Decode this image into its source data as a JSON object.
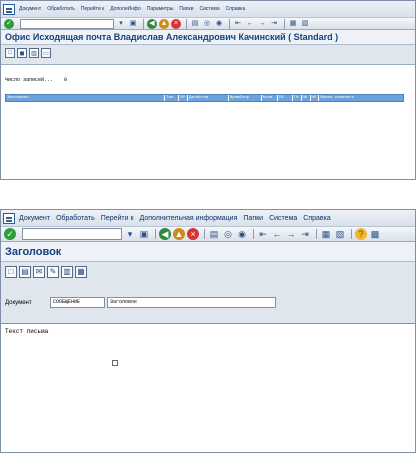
{
  "window1": {
    "menu": [
      "Документ",
      "Обработать",
      "Перейти к",
      "ДополнИнфо",
      "Параметры",
      "Папки",
      "Система",
      "Справка"
    ],
    "command_value": "",
    "title": "Офис  Исходящая почта  Владислав Александрович Качинский  ( Standard )",
    "record_count_label": "Число записей...",
    "record_count": "0",
    "columns": [
      {
        "label": "Заголовок"
      },
      {
        "label": "Тип"
      },
      {
        "label": "ПР"
      },
      {
        "label": "ДатаОтпр"
      },
      {
        "label": "ВремОтпр"
      },
      {
        "label": "Колв"
      },
      {
        "label": "СП"
      },
      {
        "label": "ТФ"
      },
      {
        "label": "ОК"
      },
      {
        "label": "НП"
      },
      {
        "label": "Можно изменить"
      }
    ]
  },
  "window2": {
    "menu": [
      "Документ",
      "Обработать",
      "Перейти к",
      "Дополнительная информация",
      "Папки",
      "Система",
      "Справка"
    ],
    "command_value": "",
    "title": "Заголовок",
    "document_label": "Документ",
    "document_type": "СООБЩЕНИЕ",
    "document_title": "Заголовок",
    "body_text": "Текст письма"
  },
  "icons": {
    "toolbar": [
      "check-icon",
      "save-icon",
      "back-icon",
      "exit-icon",
      "cancel-icon",
      "print-icon",
      "find-icon",
      "find-next-icon",
      "first-page-icon",
      "previous-page-icon",
      "next-page-icon",
      "last-page-icon",
      "new-session-icon",
      "shortcut-icon",
      "help-icon"
    ],
    "accent_colors": {
      "title": "#16417c",
      "header": "#6aa2dd",
      "check": "#2f9c3a",
      "back": "#2d8a3d",
      "exit": "#d28a17",
      "cancel": "#d93434",
      "help": "#f0b72d"
    }
  }
}
